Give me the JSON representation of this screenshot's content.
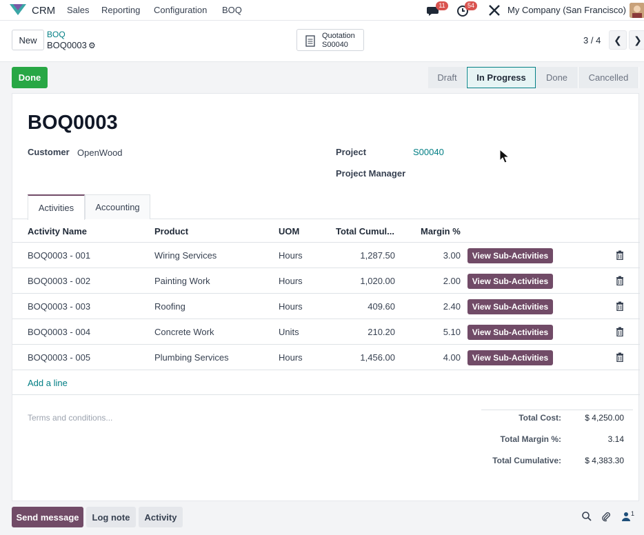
{
  "navbar": {
    "app_name": "CRM",
    "menus": [
      "Sales",
      "Reporting",
      "Configuration",
      "BOQ"
    ],
    "messages_count": "11",
    "activities_count": "54",
    "company": "My Company (San Francisco)"
  },
  "control": {
    "new_label": "New",
    "breadcrumb_parent": "BOQ",
    "breadcrumb_current": "BOQ0003",
    "smart_button_title": "Quotation",
    "smart_button_value": "S00040",
    "pager": "3 / 4"
  },
  "status": {
    "done_button": "Done",
    "steps": [
      "Draft",
      "In Progress",
      "Done",
      "Cancelled"
    ],
    "active_step": "In Progress"
  },
  "form": {
    "title": "BOQ0003",
    "customer_label": "Customer",
    "customer_value": "OpenWood",
    "project_label": "Project",
    "project_value": "S00040",
    "project_manager_label": "Project Manager",
    "project_manager_value": ""
  },
  "tabs": [
    "Activities",
    "Accounting"
  ],
  "table": {
    "columns": [
      "Activity Name",
      "Product",
      "UOM",
      "Total Cumul...",
      "Margin %"
    ],
    "sub_button_label": "View Sub-Activities",
    "rows": [
      {
        "name": "BOQ0003 - 001",
        "product": "Wiring Services",
        "uom": "Hours",
        "total": "1,287.50",
        "margin": "3.00"
      },
      {
        "name": "BOQ0003 - 002",
        "product": "Painting Work",
        "uom": "Hours",
        "total": "1,020.00",
        "margin": "2.00"
      },
      {
        "name": "BOQ0003 - 003",
        "product": "Roofing",
        "uom": "Hours",
        "total": "409.60",
        "margin": "2.40"
      },
      {
        "name": "BOQ0003 - 004",
        "product": "Concrete Work",
        "uom": "Units",
        "total": "210.20",
        "margin": "5.10"
      },
      {
        "name": "BOQ0003 - 005",
        "product": "Plumbing Services",
        "uom": "Hours",
        "total": "1,456.00",
        "margin": "4.00"
      }
    ],
    "add_line": "Add a line"
  },
  "footer": {
    "terms_placeholder": "Terms and conditions...",
    "total_cost_label": "Total Cost:",
    "total_cost_value": "$ 4,250.00",
    "total_margin_label": "Total Margin %:",
    "total_margin_value": "3.14",
    "total_cumulative_label": "Total Cumulative:",
    "total_cumulative_value": "$ 4,383.30"
  },
  "chatter": {
    "send_message": "Send message",
    "log_note": "Log note",
    "activity": "Activity",
    "followers_count": "1"
  },
  "colors": {
    "brand": "#714b67",
    "link": "#017e84",
    "success": "#28a745",
    "badge": "#d9534f"
  }
}
